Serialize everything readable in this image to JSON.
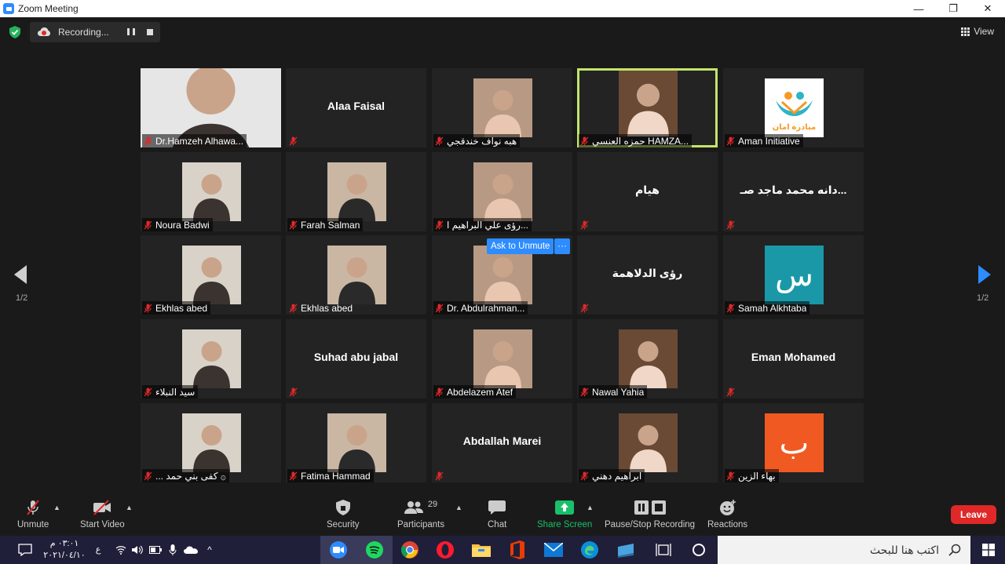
{
  "window": {
    "title": "Zoom Meeting",
    "controls": {
      "minimize": "—",
      "restore": "❐",
      "close": "✕"
    }
  },
  "top": {
    "recording_label": "Recording...",
    "view_label": "View"
  },
  "pager": {
    "left": "1/2",
    "right": "1/2"
  },
  "tiles": [
    {
      "name": "Dr.Hamzeh Alhawa...",
      "type": "photo",
      "big": ""
    },
    {
      "name": "",
      "type": "text",
      "big": "Alaa Faisal"
    },
    {
      "name": "هبه نواف خندقجي",
      "type": "photo",
      "big": ""
    },
    {
      "name": "حمزه العنسي HAMZA...",
      "type": "photo",
      "big": "",
      "active": true
    },
    {
      "name": "Aman Initiative",
      "type": "logo",
      "big": "",
      "logo_text": "مبادرة امان"
    },
    {
      "name": "Noura Badwi",
      "type": "photo",
      "big": ""
    },
    {
      "name": "Farah Salman",
      "type": "photo",
      "big": ""
    },
    {
      "name": "رؤى علي البراهيم ا...",
      "type": "photo",
      "big": ""
    },
    {
      "name": "",
      "type": "text",
      "big": "هيام"
    },
    {
      "name": "",
      "type": "text",
      "big": "دانه محمد ماجد صـ..."
    },
    {
      "name": "Ekhlas abed",
      "type": "photo",
      "big": ""
    },
    {
      "name": "Ekhlas abed",
      "type": "photo",
      "big": "",
      "plain": true
    },
    {
      "name": "Dr. Abdulrahman...",
      "type": "photo",
      "big": ""
    },
    {
      "name": "",
      "type": "text",
      "big": "رؤى الدلاهمة"
    },
    {
      "name": "Samah Alkhtaba",
      "type": "letter",
      "big": "",
      "letter": "س",
      "letter_color": "#1a98a8"
    },
    {
      "name": "سيد النبلاء",
      "type": "photo",
      "big": ""
    },
    {
      "name": "",
      "type": "text",
      "big": "Suhad abu jabal"
    },
    {
      "name": "Abdelazem Atef",
      "type": "photo",
      "big": ""
    },
    {
      "name": "Nawal Yahia",
      "type": "photo",
      "big": ""
    },
    {
      "name": "",
      "type": "text",
      "big": "Eman Mohamed"
    },
    {
      "name": "... كفى بني حمد ۞",
      "type": "photo",
      "big": ""
    },
    {
      "name": "Fatima Hammad",
      "type": "photo",
      "big": ""
    },
    {
      "name": "",
      "type": "text",
      "big": "Abdallah Marei"
    },
    {
      "name": "ابراهيم دهني",
      "type": "photo",
      "big": ""
    },
    {
      "name": "بهاء الزين",
      "type": "letter",
      "big": "",
      "letter": "ب",
      "letter_color": "#f05a22"
    }
  ],
  "ask_unmute": {
    "label": "Ask to Unmute",
    "more": "···"
  },
  "controls": {
    "unmute": "Unmute",
    "start_video": "Start Video",
    "security": "Security",
    "participants": "Participants",
    "participants_count": "29",
    "chat": "Chat",
    "share_screen": "Share Screen",
    "pause_stop": "Pause/Stop Recording",
    "reactions": "Reactions",
    "leave": "Leave"
  },
  "taskbar": {
    "search_placeholder": "اكتب هنا للبحث",
    "time": "٠٣:٠١ م",
    "date": "٢٠٢١/٠٤/١٠",
    "lang": "ع"
  },
  "colors": {
    "accent": "#2d8cff",
    "active_speaker": "#c4e46a",
    "leave": "#e02828",
    "share_green": "#19c06a",
    "muted_red": "#e02828"
  }
}
